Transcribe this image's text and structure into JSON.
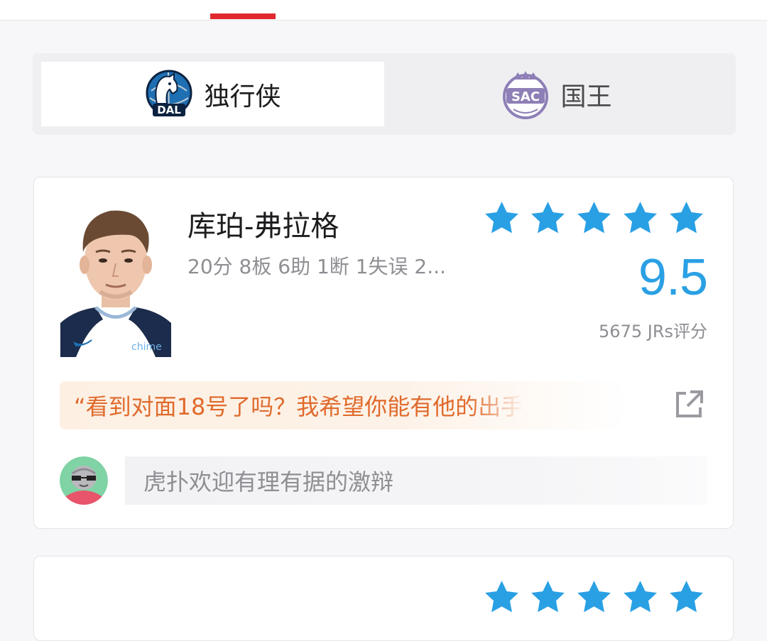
{
  "teams": {
    "home": {
      "name": "独行侠",
      "abbr": "DAL",
      "icon": "mavericks-logo-icon"
    },
    "away": {
      "name": "国王",
      "abbr": "SAC",
      "icon": "kings-logo-icon"
    }
  },
  "player_card": {
    "name": "库珀-弗拉格",
    "stats": "20分 8板 6助 1断 1失误 2...",
    "stars": 5,
    "score": "9.5",
    "rating_count": "5675 JRs评分",
    "jersey_text": "chime",
    "quote": "“看到对面18号了吗？我希望你能有他的出手",
    "comment_placeholder": "虎扑欢迎有理有据的激辩",
    "icons": {
      "share": "external-share-icon",
      "star": "star-icon",
      "avatar": "user-avatar-icon"
    }
  },
  "colors": {
    "accent_red": "#e0282e",
    "star_blue": "#2aa0e4",
    "quote_orange": "#e06a2c",
    "kings_purple": "#8e7fb6",
    "mavs_blue": "#1f6fb3"
  }
}
